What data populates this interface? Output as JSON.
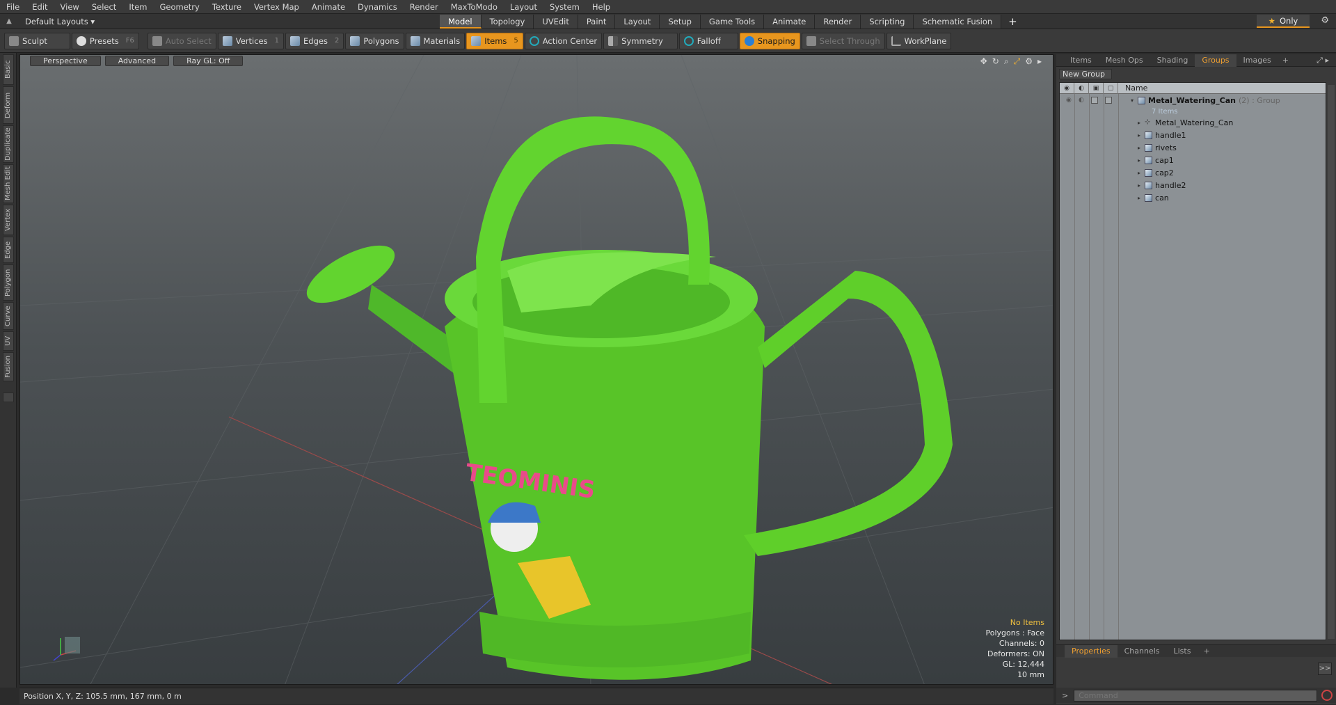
{
  "menu": [
    "File",
    "Edit",
    "View",
    "Select",
    "Item",
    "Geometry",
    "Texture",
    "Vertex Map",
    "Animate",
    "Dynamics",
    "Render",
    "MaxToModo",
    "Layout",
    "System",
    "Help"
  ],
  "layout": {
    "name": "Default Layouts ▾"
  },
  "tabs": [
    {
      "label": "Model",
      "active": true
    },
    {
      "label": "Topology"
    },
    {
      "label": "UVEdit"
    },
    {
      "label": "Paint"
    },
    {
      "label": "Layout"
    },
    {
      "label": "Setup"
    },
    {
      "label": "Game Tools"
    },
    {
      "label": "Animate"
    },
    {
      "label": "Render"
    },
    {
      "label": "Scripting"
    },
    {
      "label": "Schematic Fusion"
    }
  ],
  "only_label": "Only",
  "toolbar": {
    "sculpt": "Sculpt",
    "presets": "Presets",
    "presets_key": "F6",
    "auto_select": "Auto Select",
    "vertices": "Vertices",
    "vertices_key": "1",
    "edges": "Edges",
    "edges_key": "2",
    "polygons": "Polygons",
    "materials": "Materials",
    "items": "Items",
    "items_key": "5",
    "action_center": "Action Center",
    "symmetry": "Symmetry",
    "falloff": "Falloff",
    "snapping": "Snapping",
    "select_through": "Select Through",
    "workplane": "WorkPlane"
  },
  "left_tabs": [
    "Basic",
    "Deform",
    "Duplicate",
    "Mesh Edit",
    "Vertex",
    "Edge",
    "Polygon",
    "Curve",
    "UV",
    "Fusion"
  ],
  "viewport": {
    "view": "Perspective",
    "shading": "Advanced",
    "raygl": "Ray GL: Off",
    "info": {
      "items": "No Items",
      "polygons": "Polygons : Face",
      "channels": "Channels: 0",
      "deformers": "Deformers: ON",
      "gl": "GL: 12,444",
      "scale": "10 mm"
    },
    "logo_text": "TEOMINIS"
  },
  "status": "Position X, Y, Z:   105.5 mm, 167 mm, 0 m",
  "right_panel": {
    "tabs": [
      {
        "label": "Items"
      },
      {
        "label": "Mesh Ops"
      },
      {
        "label": "Shading"
      },
      {
        "label": "Groups",
        "active": true
      },
      {
        "label": "Images"
      }
    ],
    "new_group": "New Group",
    "col_name": "Name",
    "group": {
      "name": "Metal_Watering_Can",
      "meta": "(2) : Group",
      "count": "7 Items"
    },
    "children": [
      {
        "name": "Metal_Watering_Can",
        "kind": "locator"
      },
      {
        "name": "handle1",
        "kind": "mesh"
      },
      {
        "name": "rivets",
        "kind": "mesh"
      },
      {
        "name": "cap1",
        "kind": "mesh"
      },
      {
        "name": "cap2",
        "kind": "mesh"
      },
      {
        "name": "handle2",
        "kind": "mesh"
      },
      {
        "name": "can",
        "kind": "mesh"
      }
    ],
    "bottom_tabs": [
      {
        "label": "Properties",
        "active": true
      },
      {
        "label": "Channels"
      },
      {
        "label": "Lists"
      }
    ],
    "arrow": ">>",
    "command_placeholder": "Command"
  },
  "colors": {
    "accent": "#e8961e",
    "can_green": "#5fcf2a",
    "viewport_top": "#6a6e70",
    "viewport_bottom": "#383d40"
  }
}
